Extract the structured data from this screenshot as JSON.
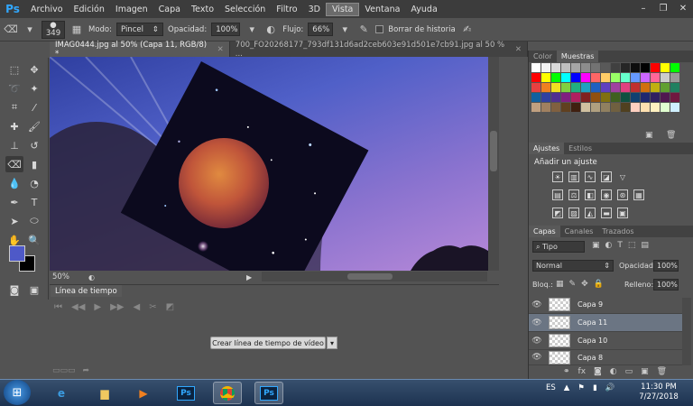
{
  "app": {
    "logo": "Ps"
  },
  "menu": [
    "Archivo",
    "Edición",
    "Imagen",
    "Capa",
    "Texto",
    "Selección",
    "Filtro",
    "3D",
    "Vista",
    "Ventana",
    "Ayuda"
  ],
  "menu_active": "Vista",
  "window_buttons": [
    "–",
    "❐",
    "✕"
  ],
  "options": {
    "brush_size": "349",
    "mode_label": "Modo:",
    "mode_value": "Pincel",
    "opacity_label": "Opacidad:",
    "opacity_value": "100%",
    "flow_label": "Flujo:",
    "flow_value": "66%",
    "history_label": "Borrar de historia"
  },
  "doc_tabs": [
    {
      "label": "IMAG0444.jpg al 50% (Capa 11, RGB/8) *",
      "active": true
    },
    {
      "label": "700_FO20268177_793df131d6ad2ceb603e91d501e7cb91.jpg al 50 % ...",
      "active": false
    }
  ],
  "status": {
    "zoom": "50%"
  },
  "timeline": {
    "tab": "Línea de tiempo",
    "create_button": "Crear línea de tiempo de vídeo"
  },
  "panels": {
    "color_tabs": [
      "Color",
      "Muestras"
    ],
    "color_active": "Muestras",
    "adjust_tabs": [
      "Ajustes",
      "Estilos"
    ],
    "adjust_active": "Ajustes",
    "adjust_title": "Añadir un ajuste",
    "layer_tabs": [
      "Capas",
      "Canales",
      "Trazados"
    ],
    "layer_active": "Capas",
    "filter_kind": "Tipo",
    "blend_mode": "Normal",
    "opacity_label": "Opacidad:",
    "opacity_value": "100%",
    "lock_label": "Bloq.:",
    "fill_label": "Relleno:",
    "fill_value": "100%",
    "layers": [
      {
        "name": "Capa 9",
        "selected": false
      },
      {
        "name": "Capa 11",
        "selected": true
      },
      {
        "name": "Capa 10",
        "selected": false
      },
      {
        "name": "Capa 8",
        "selected": false
      }
    ]
  },
  "swatch_colors": [
    "#ffffff",
    "#f2f2f2",
    "#d9d9d9",
    "#bfbfbf",
    "#a6a6a6",
    "#8c8c8c",
    "#737373",
    "#595959",
    "#404040",
    "#262626",
    "#0d0d0d",
    "#000000",
    "#ff0000",
    "#ffff00",
    "#00ff00",
    "#ff0000",
    "#ffff00",
    "#00ff00",
    "#00ffff",
    "#0000ff",
    "#ff00ff",
    "#ff6666",
    "#ffcc66",
    "#99ff66",
    "#66ffcc",
    "#6699ff",
    "#cc66ff",
    "#ff6699",
    "#cccccc",
    "#999999",
    "#e84040",
    "#f08020",
    "#f0e020",
    "#80d040",
    "#20b080",
    "#20a0c0",
    "#2060c0",
    "#6040c0",
    "#a040a0",
    "#e04080",
    "#c03030",
    "#d07010",
    "#c0b010",
    "#60a030",
    "#208060",
    "#1060a0",
    "#3040a0",
    "#503090",
    "#802080",
    "#b02060",
    "#802020",
    "#905010",
    "#807010",
    "#406020",
    "#105040",
    "#104070",
    "#202870",
    "#302060",
    "#501850",
    "#701840",
    "#c0a080",
    "#a08060",
    "#806040",
    "#604020",
    "#402010",
    "#d0c0a0",
    "#b0a080",
    "#908060",
    "#706040",
    "#504020",
    "#ffd0c0",
    "#ffe0b0",
    "#fff0c0",
    "#e0ffd0",
    "#d0f0ff"
  ],
  "taskbar": {
    "language": "ES",
    "time": "11:30 PM",
    "date": "7/27/2018"
  }
}
